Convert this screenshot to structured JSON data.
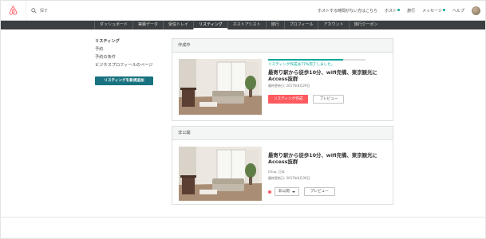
{
  "header": {
    "search_placeholder": "探す",
    "links": {
      "trip_help": "ホストする時間がない方はこちら",
      "host": "ホスト",
      "trips": "旅行",
      "messages": "メッセージ",
      "help": "ヘルプ"
    }
  },
  "subnav": {
    "items": [
      "ダッシュボード",
      "実績データ",
      "受信トレイ",
      "リスティング",
      "ホストアシスト",
      "旅行",
      "プロフィール",
      "アカウント",
      "旅行クーポン"
    ],
    "active_index": 3
  },
  "sidebar": {
    "items": [
      "リスティング",
      "予約",
      "予約の条件",
      "ビジネスプロフィールのページ"
    ],
    "add_button": "リスティングを新規追加"
  },
  "in_progress": {
    "header": "作成中",
    "progress_text": "リスティング作成は77%完了しました。",
    "progress": 0.77,
    "title": "最寄り駅から徒歩10分、wifi完備、東京観光にAccess抜群",
    "updated": "最終更新日: 2017年8月29日",
    "primary_button": "リスティング作成",
    "preview_button": "プレビュー"
  },
  "unlisted": {
    "header": "非公開",
    "title": "最寄り駅から徒歩10分、wifi完備、東京観光にAccess抜群",
    "location": "Chuo, 日本",
    "updated": "最終更新日: 2017年6月30日",
    "status_select": "非公開",
    "preview_button": "プレビュー"
  },
  "colors": {
    "accent_teal": "#00a699",
    "button_teal": "#18727f",
    "brand_red": "#ff5a5f",
    "nav_dark": "#3c3f41"
  }
}
